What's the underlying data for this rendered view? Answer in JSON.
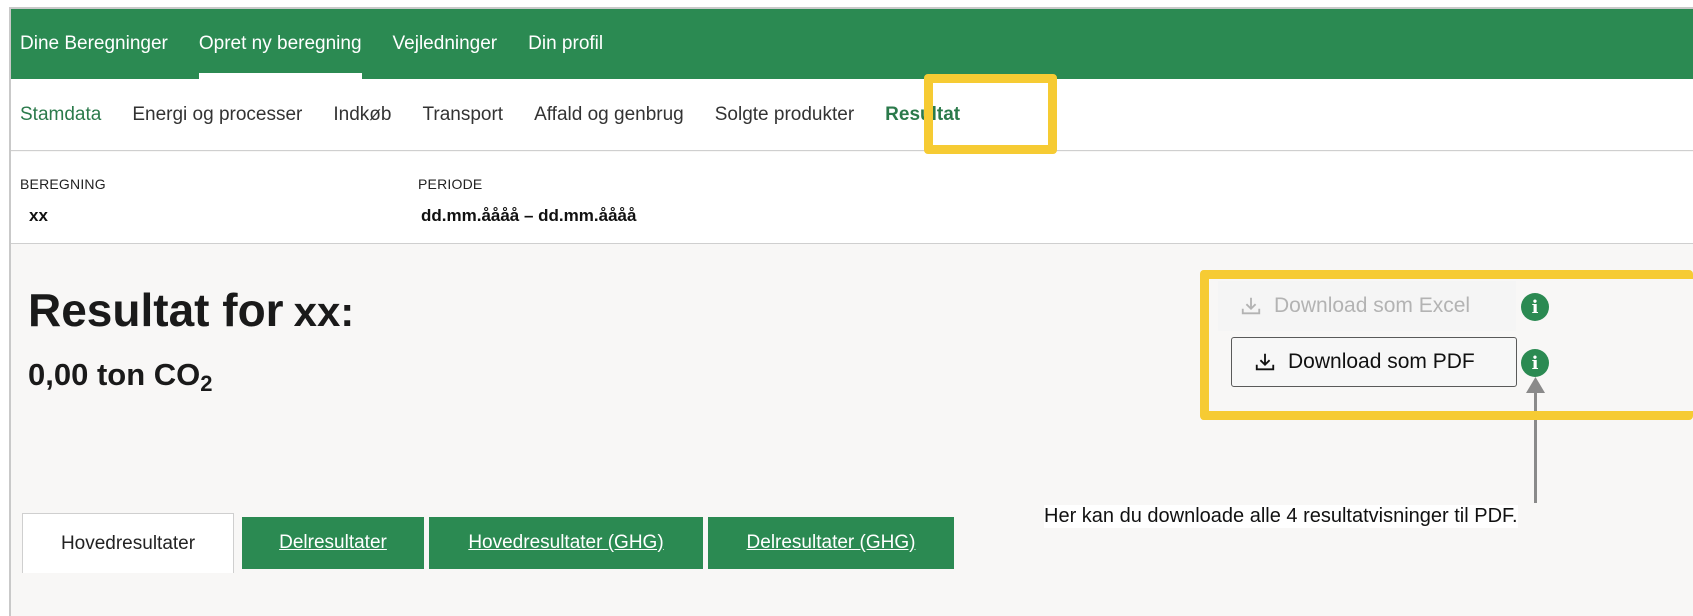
{
  "top_nav": {
    "items": [
      {
        "label": "Dine Beregninger"
      },
      {
        "label": "Opret ny beregning",
        "active": true
      },
      {
        "label": "Vejledninger"
      },
      {
        "label": "Din profil"
      }
    ]
  },
  "sub_nav": {
    "items": [
      {
        "label": "Stamdata"
      },
      {
        "label": "Energi og processer"
      },
      {
        "label": "Indkøb"
      },
      {
        "label": "Transport"
      },
      {
        "label": "Affald og genbrug"
      },
      {
        "label": "Solgte produkter"
      },
      {
        "label": "Resultat",
        "active": true
      }
    ]
  },
  "info": {
    "beregning_label": "BEREGNING",
    "beregning_value": "xx",
    "periode_label": "PERIODE",
    "periode_value": "dd.mm.åååå – dd.mm.åååå"
  },
  "result": {
    "title_prefix": "Resultat for",
    "title_name": "xx:",
    "value_text": "0,00 ton CO",
    "value_subscript": "2"
  },
  "downloads": {
    "excel_label": "Download som Excel",
    "pdf_label": "Download som PDF",
    "info_glyph": "i"
  },
  "callout_text": "Her kan du downloade alle 4 resultatvisninger til PDF.",
  "tabs": [
    {
      "label": "Hovedresultater",
      "active": true
    },
    {
      "label": "Delresultater"
    },
    {
      "label": "Hovedresultater (GHG)"
    },
    {
      "label": "Delresultater (GHG)"
    }
  ],
  "colors": {
    "brand_green": "#2b8a52",
    "highlight_yellow": "#f6cb33"
  },
  "icons": [
    "download-icon",
    "info-icon"
  ]
}
